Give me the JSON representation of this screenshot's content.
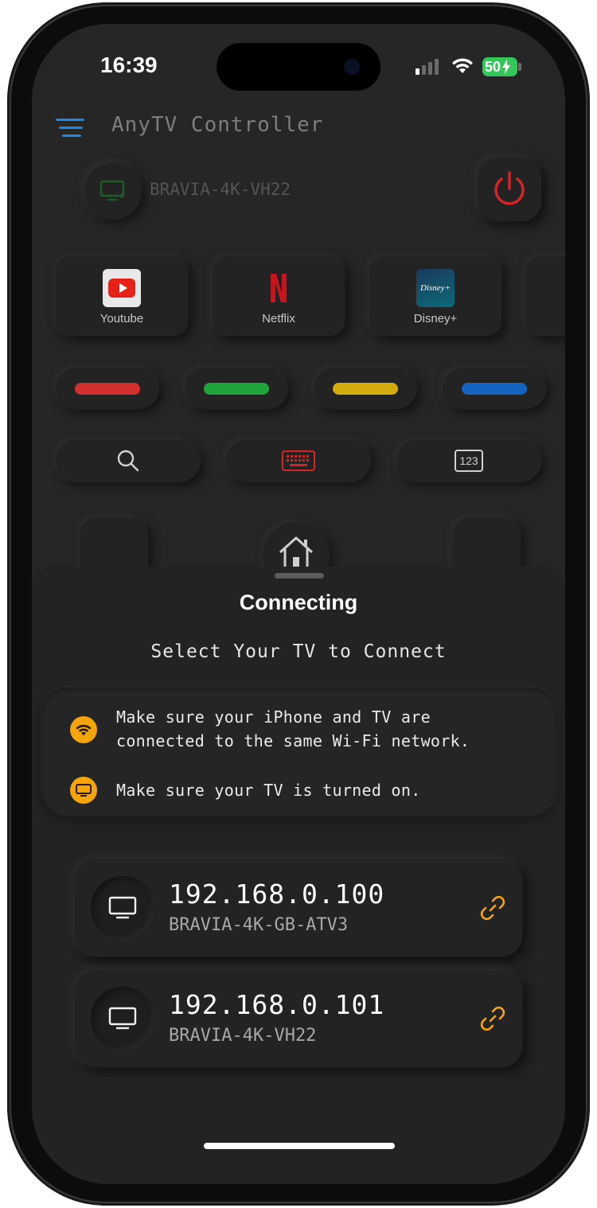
{
  "status_bar": {
    "time": "16:39",
    "battery": "50",
    "icons": [
      "signal-icon",
      "wifi-icon",
      "charging-icon"
    ]
  },
  "header": {
    "title": "AnyTV Controller",
    "menu_icon": "menu-icon",
    "connected_device": "BRAVIA-4K-VH22",
    "accent": "#1e88e5"
  },
  "apps": [
    {
      "label": "Youtube",
      "icon": "youtube-icon"
    },
    {
      "label": "Netflix",
      "icon": "netflix-icon"
    },
    {
      "label": "Disney+",
      "icon": "disney-plus-icon",
      "logo_text": "Disney+"
    }
  ],
  "color_keys": [
    "#d32f2f",
    "#1fa33a",
    "#d4ac0d",
    "#1565c0"
  ],
  "utility_buttons": [
    {
      "name": "search",
      "icon": "search-icon"
    },
    {
      "name": "keyboard",
      "icon": "keyboard-icon"
    },
    {
      "name": "numpad",
      "icon": "numpad-icon",
      "label": "123"
    }
  ],
  "sheet": {
    "title": "Connecting",
    "subtitle": "Select Your TV to Connect",
    "tips": [
      {
        "icon": "wifi-icon",
        "line1": "Make sure your iPhone and TV are",
        "line2": "connected to the same Wi-Fi network."
      },
      {
        "icon": "tv-icon",
        "line1": "Make sure your TV is turned on.",
        "line2": ""
      }
    ],
    "tip_color": "#f5a50a",
    "devices": [
      {
        "ip": "192.168.0.100",
        "name": "BRAVIA-4K-GB-ATV3",
        "icon": "tv-icon",
        "action_icon": "link-icon"
      },
      {
        "ip": "192.168.0.101",
        "name": "BRAVIA-4K-VH22",
        "icon": "tv-icon",
        "action_icon": "link-icon"
      }
    ]
  }
}
